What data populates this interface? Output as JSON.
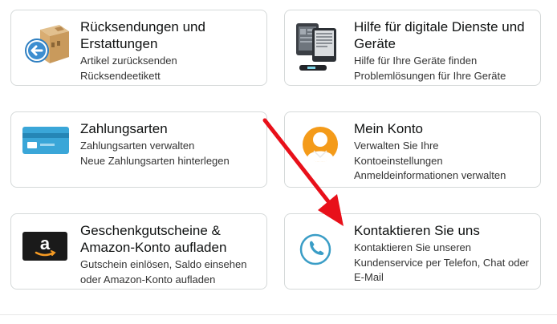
{
  "cards": [
    {
      "title": "Rücksendungen und Erstattungen",
      "lines": [
        "Artikel zurücksenden",
        "Rücksendeetikett"
      ],
      "icon": "return-package-icon"
    },
    {
      "title": "Hilfe für digitale Dienste und Geräte",
      "lines": [
        "Hilfe für Ihre Geräte finden",
        "Problemlösungen für Ihre Geräte"
      ],
      "icon": "devices-icon"
    },
    {
      "title": "Zahlungsarten",
      "lines": [
        "Zahlungsarten verwalten",
        "Neue Zahlungsarten hinterlegen"
      ],
      "icon": "credit-card-icon"
    },
    {
      "title": "Mein Konto",
      "lines": [
        "Verwalten Sie Ihre",
        "Kontoeinstellungen",
        "Anmeldeinformationen verwalten"
      ],
      "icon": "user-avatar-icon"
    },
    {
      "title": "Geschenkgutscheine & Amazon-Konto aufladen",
      "lines": [
        "Gutschein einlösen, Saldo einsehen",
        "oder Amazon-Konto aufladen"
      ],
      "icon": "gift-card-icon"
    },
    {
      "title": "Kontaktieren Sie uns",
      "lines": [
        "Kontaktieren Sie unseren",
        "Kundenservice per Telefon, Chat oder",
        "E-Mail"
      ],
      "icon": "phone-icon"
    }
  ],
  "colors": {
    "border": "#d5d9d9",
    "arrow": "#e8101a",
    "card_blue": "#3aa6d8",
    "phone_blue": "#3a9dc6",
    "avatar_orange": "#f49b1a"
  }
}
